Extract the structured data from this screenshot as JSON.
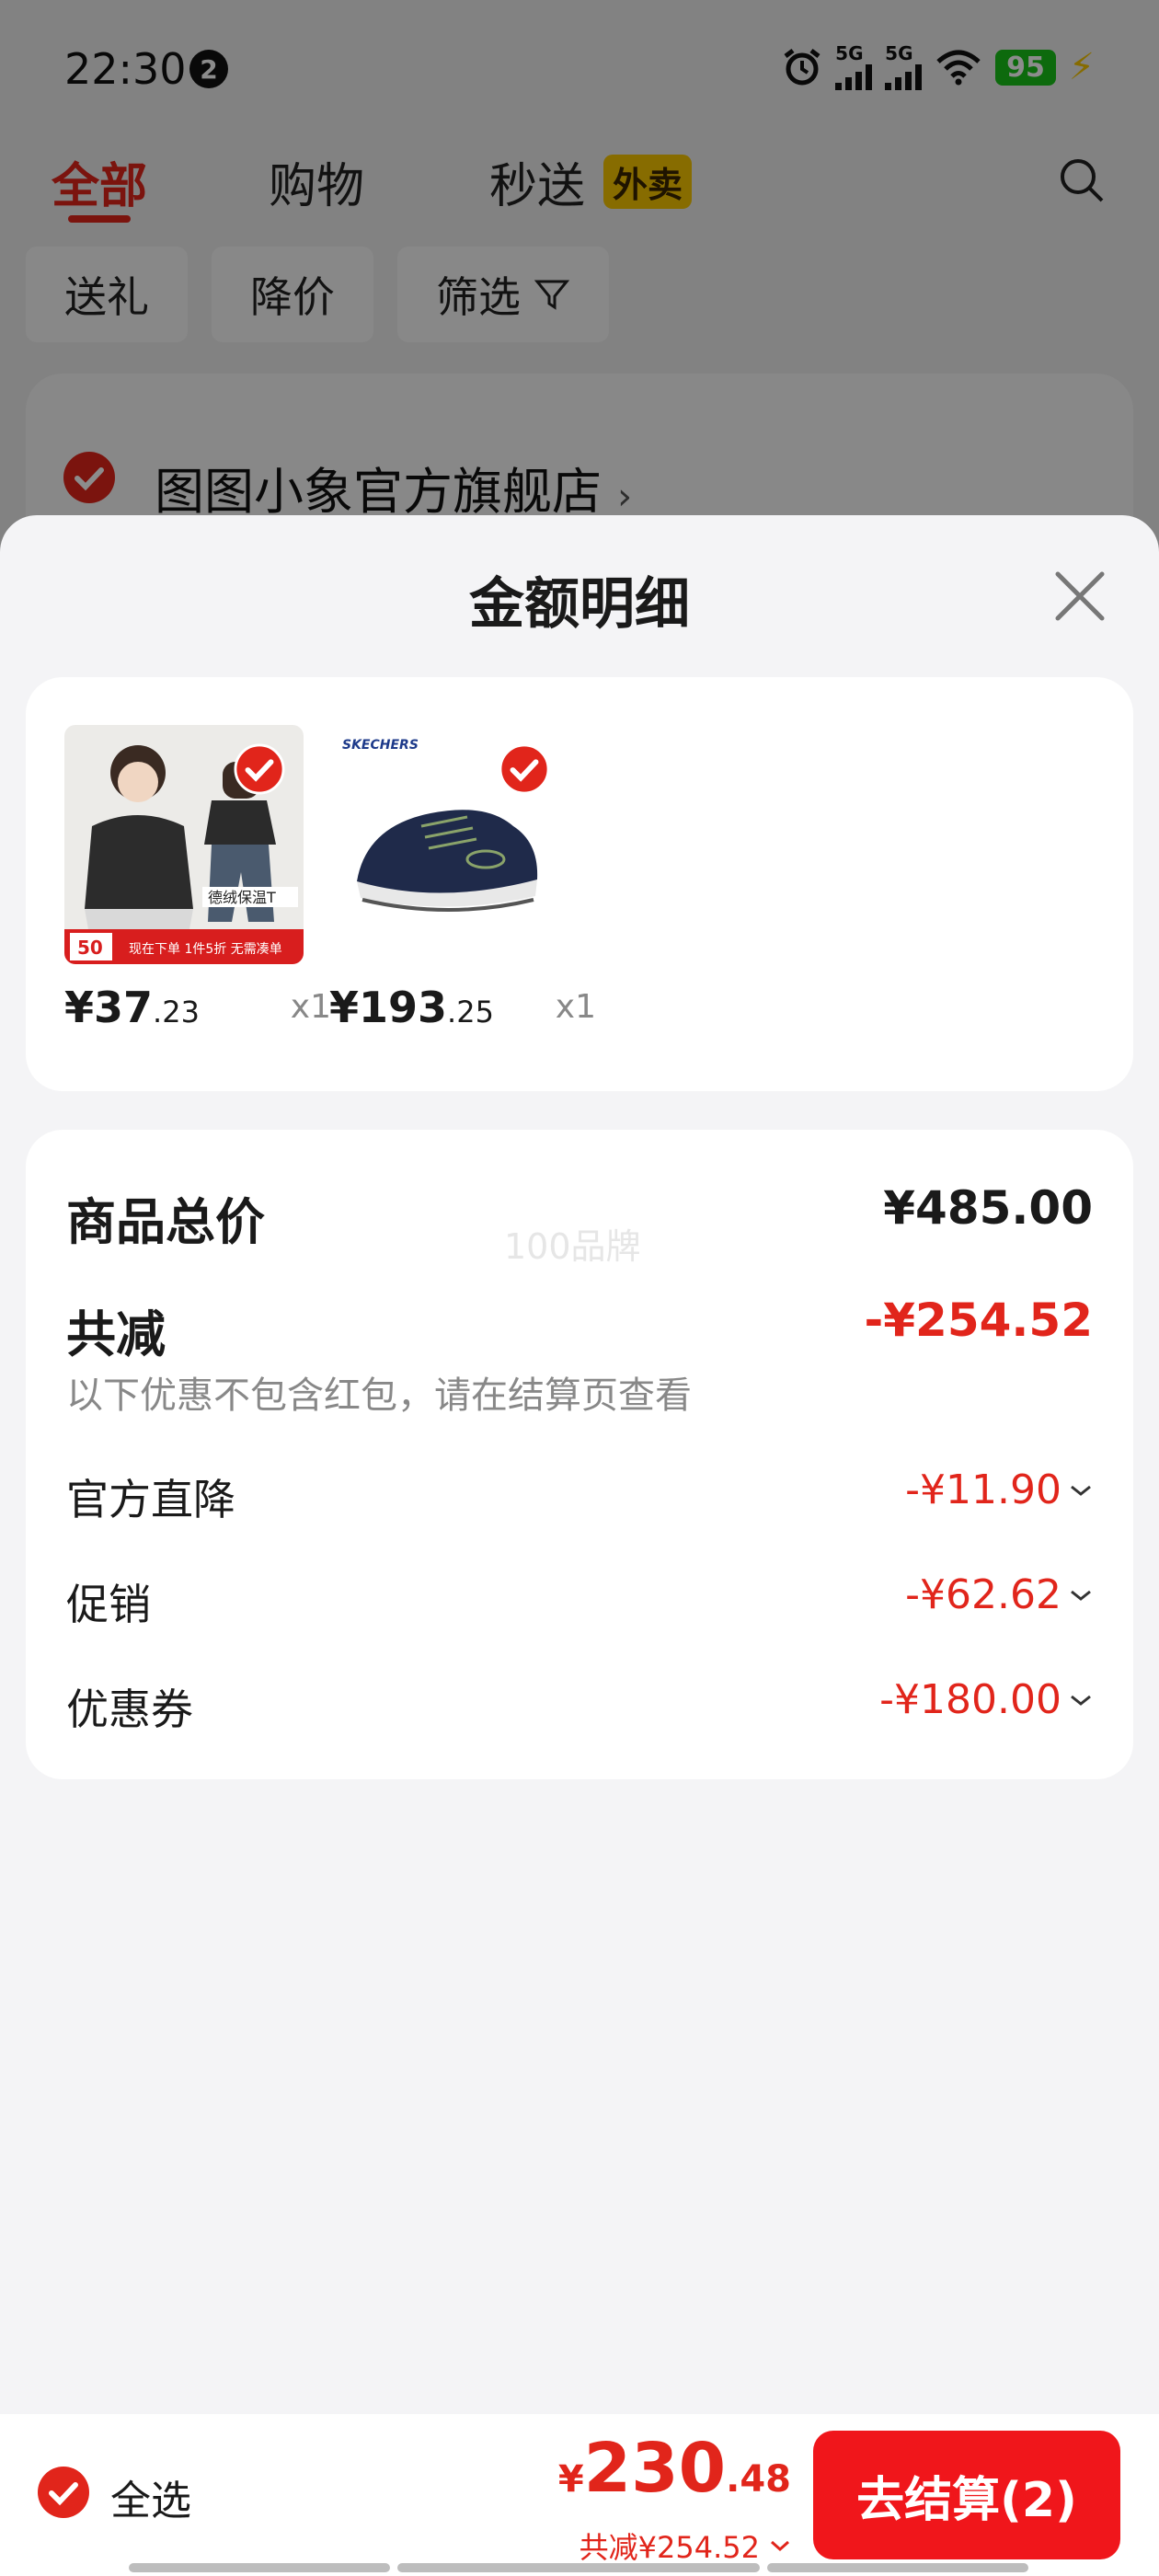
{
  "status_bar": {
    "time": "22:30",
    "notification_count": "2",
    "signal_1_label": "5G",
    "signal_2_label": "5G",
    "battery": "95"
  },
  "top_tabs": {
    "all": "全部",
    "shopping": "购物",
    "express": "秒送",
    "waimai_badge": "外卖"
  },
  "filters": {
    "gift": "送礼",
    "price_drop": "降价",
    "filter": "筛选"
  },
  "store": {
    "name": "图图小象官方旗舰店",
    "arrow": "›"
  },
  "sheet": {
    "title": "金额明细",
    "items": [
      {
        "price_int": "¥37",
        "price_dec": ".23",
        "qty": "x1"
      },
      {
        "price_int": "¥193",
        "price_dec": ".25",
        "qty": "x1"
      }
    ],
    "total_label": "商品总价",
    "total_value": "¥485.00",
    "watermark": "100品牌",
    "discount_label": "共减",
    "discount_value": "-¥254.52",
    "discount_note": "以下优惠不包含红包，请在结算页查看",
    "official_drop_label": "官方直降",
    "official_drop_value": "-¥11.90",
    "promo_label": "促销",
    "promo_value": "-¥62.62",
    "coupon_label": "优惠券",
    "coupon_value": "-¥180.00"
  },
  "bottom_bar": {
    "select_all": "全选",
    "currency": "¥",
    "total_int": "230",
    "total_dec": ".48",
    "saved_text": "共减¥254.52",
    "checkout_label": "去结算(2)"
  },
  "colors": {
    "accent_red": "#e1251b",
    "checkout_red": "#f0161b",
    "waimai_yellow": "#f6c500",
    "battery_green": "#18c218"
  }
}
